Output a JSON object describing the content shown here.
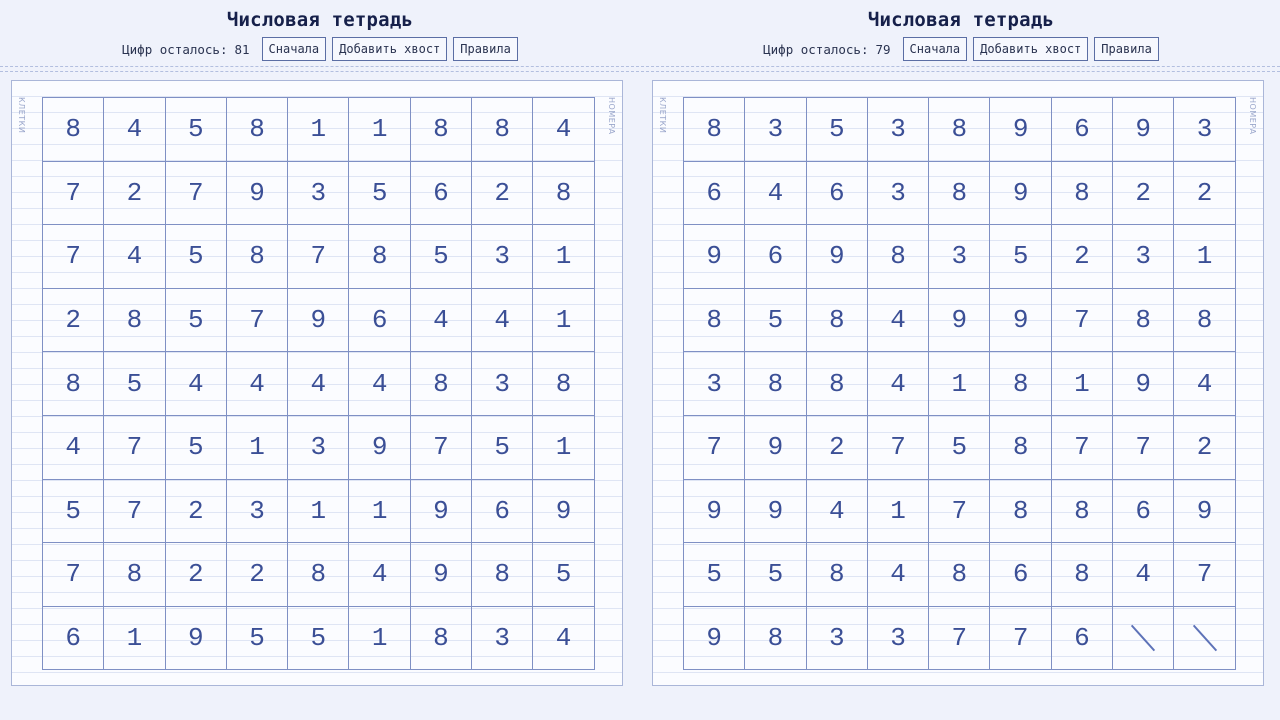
{
  "panels": [
    {
      "title": "Числовая тетрадь",
      "counter_label": "Цифр осталось:",
      "counter_value": "81",
      "buttons": {
        "restart": "Сначала",
        "add_tail": "Добавить хвост",
        "rules": "Правила"
      },
      "margin_left": "клетки",
      "margin_right": "номера",
      "grid": [
        [
          "8",
          "4",
          "5",
          "8",
          "1",
          "1",
          "8",
          "8",
          "4"
        ],
        [
          "7",
          "2",
          "7",
          "9",
          "3",
          "5",
          "6",
          "2",
          "8"
        ],
        [
          "7",
          "4",
          "5",
          "8",
          "7",
          "8",
          "5",
          "3",
          "1"
        ],
        [
          "2",
          "8",
          "5",
          "7",
          "9",
          "6",
          "4",
          "4",
          "1"
        ],
        [
          "8",
          "5",
          "4",
          "4",
          "4",
          "4",
          "8",
          "3",
          "8"
        ],
        [
          "4",
          "7",
          "5",
          "1",
          "3",
          "9",
          "7",
          "5",
          "1"
        ],
        [
          "5",
          "7",
          "2",
          "3",
          "1",
          "1",
          "9",
          "6",
          "9"
        ],
        [
          "7",
          "8",
          "2",
          "2",
          "8",
          "4",
          "9",
          "8",
          "5"
        ],
        [
          "6",
          "1",
          "9",
          "5",
          "5",
          "1",
          "8",
          "3",
          "4"
        ]
      ]
    },
    {
      "title": "Числовая тетрадь",
      "counter_label": "Цифр осталось:",
      "counter_value": "79",
      "buttons": {
        "restart": "Сначала",
        "add_tail": "Добавить хвост",
        "rules": "Правила"
      },
      "margin_left": "клетки",
      "margin_right": "номера",
      "grid": [
        [
          "8",
          "3",
          "5",
          "3",
          "8",
          "9",
          "6",
          "9",
          "3"
        ],
        [
          "6",
          "4",
          "6",
          "3",
          "8",
          "9",
          "8",
          "2",
          "2"
        ],
        [
          "9",
          "6",
          "9",
          "8",
          "3",
          "5",
          "2",
          "3",
          "1"
        ],
        [
          "8",
          "5",
          "8",
          "4",
          "9",
          "9",
          "7",
          "8",
          "8"
        ],
        [
          "3",
          "8",
          "8",
          "4",
          "1",
          "8",
          "1",
          "9",
          "4"
        ],
        [
          "7",
          "9",
          "2",
          "7",
          "5",
          "8",
          "7",
          "7",
          "2"
        ],
        [
          "9",
          "9",
          "4",
          "1",
          "7",
          "8",
          "8",
          "6",
          "9"
        ],
        [
          "5",
          "5",
          "8",
          "4",
          "8",
          "6",
          "8",
          "4",
          "7"
        ],
        [
          "9",
          "8",
          "3",
          "3",
          "7",
          "7",
          "6",
          "",
          ""
        ]
      ],
      "crossed_cells": [
        [
          8,
          7
        ],
        [
          8,
          8
        ]
      ]
    }
  ]
}
